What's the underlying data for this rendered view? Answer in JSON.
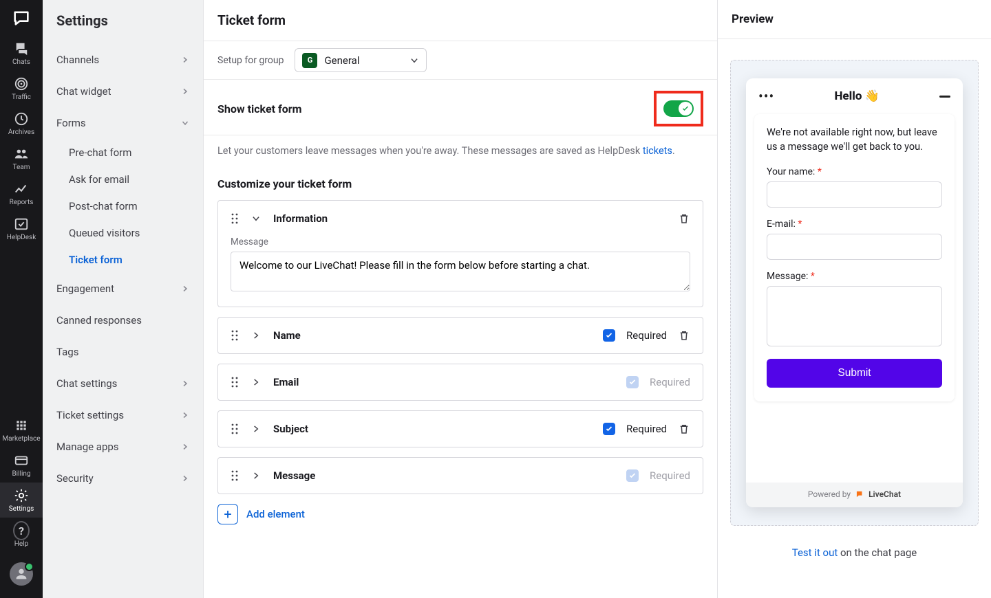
{
  "iconNav": {
    "chats": "Chats",
    "traffic": "Traffic",
    "archives": "Archives",
    "team": "Team",
    "reports": "Reports",
    "helpdesk": "HelpDesk",
    "marketplace": "Marketplace",
    "billing": "Billing",
    "settings": "Settings",
    "help": "Help"
  },
  "sidebar": {
    "title": "Settings",
    "items": {
      "channels": "Channels",
      "chatWidget": "Chat widget",
      "forms": "Forms",
      "engagement": "Engagement",
      "cannedResponses": "Canned responses",
      "tags": "Tags",
      "chatSettings": "Chat settings",
      "ticketSettings": "Ticket settings",
      "manageApps": "Manage apps",
      "security": "Security"
    },
    "formsSub": {
      "preChat": "Pre-chat form",
      "askEmail": "Ask for email",
      "postChat": "Post-chat form",
      "queued": "Queued visitors",
      "ticketForm": "Ticket form"
    }
  },
  "main": {
    "title": "Ticket form",
    "setupLabel": "Setup for group",
    "groupBadge": "G",
    "groupName": "General",
    "toggleLabel": "Show ticket form",
    "helpText": "Let your customers leave messages when you're away. These messages are saved as HelpDesk ",
    "ticketsLink": "tickets",
    "customizeTitle": "Customize your ticket form",
    "messageLabel": "Message",
    "welcomeMsg": "Welcome to our LiveChat! Please fill in the form below before starting a chat.",
    "fields": {
      "information": "Information",
      "name": "Name",
      "email": "Email",
      "subject": "Subject",
      "message": "Message"
    },
    "requiredLabel": "Required",
    "addElement": "Add element"
  },
  "preview": {
    "title": "Preview",
    "hello": "Hello 👋",
    "awayMsg": "We're not available right now, but leave us a message we'll get back to you.",
    "nameLabel": "Your name:",
    "emailLabel": "E-mail:",
    "messageLabel": "Message:",
    "submit": "Submit",
    "poweredBy": "Powered by",
    "brand": "LiveChat",
    "testItOut": "Test it out",
    "onChatPage": " on the chat page"
  }
}
